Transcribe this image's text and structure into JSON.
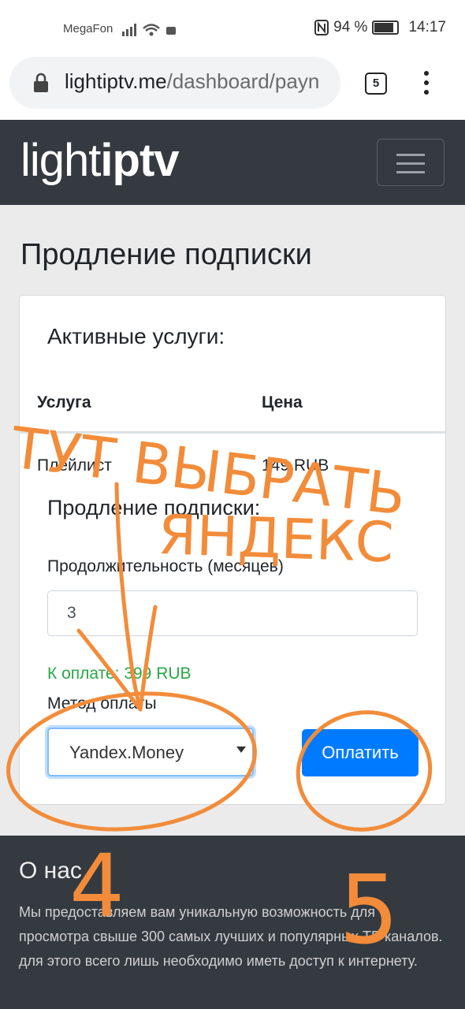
{
  "status_bar": {
    "carrier": "MegaFon",
    "battery": "94 %",
    "time": "14:17"
  },
  "browser": {
    "url_domain": "lightiptv.me",
    "url_path": "/dashboard/payn",
    "tab_count": "5"
  },
  "navbar": {
    "logo_light": "light",
    "logo_iptv": "iptv"
  },
  "page": {
    "title": "Продление подписки",
    "card": {
      "active_heading": "Активные услуги:",
      "table": {
        "headers": [
          "Услуга",
          "Цена"
        ],
        "rows": [
          {
            "service": "Плейлист",
            "price": "149 RUB"
          }
        ]
      },
      "renew_heading": "Продление подписки:",
      "duration_label": "Продолжительность (месяцев)",
      "duration_value": "3",
      "to_pay": "К оплате: 399 RUB",
      "method_label": "Метод оплаты",
      "method_value": "Yandex.Money",
      "pay_button": "Оплатить"
    }
  },
  "footer": {
    "heading": "О нас",
    "text": "Мы предоставляем вам уникальную возможность для просмотра свыше 300 самых лучших и популярных ТВ каналов. для этого всего лишь необходимо иметь доступ к интернету."
  },
  "annotations": {
    "color": "#f28c3a",
    "line1": "ТУТ ВЫБРАТЬ",
    "line2": "ЯНДЕКС",
    "step4": "4",
    "step5": "5"
  }
}
